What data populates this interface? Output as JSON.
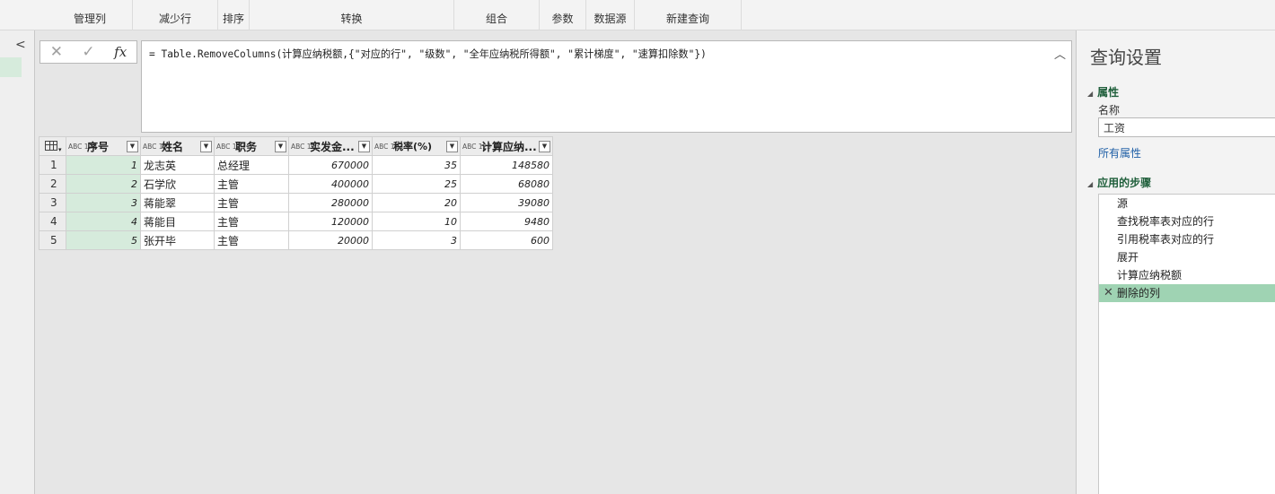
{
  "ribbon": {
    "groups": [
      "管理列",
      "减少行",
      "排序",
      "转换",
      "组合",
      "参数",
      "数据源",
      "新建查询"
    ]
  },
  "queries_pane": {
    "collapse_icon": "chevron-left-icon"
  },
  "formula_bar": {
    "cancel_icon": "✕",
    "commit_icon": "✓",
    "fx_label": "fx",
    "expression": "= Table.RemoveColumns(计算应纳税额,{\"对应的行\", \"级数\", \"全年应纳税所得额\", \"累计梯度\", \"速算扣除数\"})",
    "expand_icon": "chevron-up-icon"
  },
  "table": {
    "type_label": "ABC 123",
    "columns": [
      "序号",
      "姓名",
      "职务",
      "实发金...",
      "税率(%)",
      "计算应纳..."
    ],
    "rows": [
      {
        "n": "1",
        "cells": [
          "1",
          "龙志英",
          "总经理",
          "670000",
          "35",
          "148580"
        ]
      },
      {
        "n": "2",
        "cells": [
          "2",
          "石学欣",
          "主管",
          "400000",
          "25",
          "68080"
        ]
      },
      {
        "n": "3",
        "cells": [
          "3",
          "蒋能翠",
          "主管",
          "280000",
          "20",
          "39080"
        ]
      },
      {
        "n": "4",
        "cells": [
          "4",
          "蒋能目",
          "主管",
          "120000",
          "10",
          "9480"
        ]
      },
      {
        "n": "5",
        "cells": [
          "5",
          "张开毕",
          "主管",
          "20000",
          "3",
          "600"
        ]
      }
    ]
  },
  "settings": {
    "title": "查询设置",
    "properties_header": "属性",
    "name_label": "名称",
    "name_value": "工资",
    "all_properties_link": "所有属性",
    "steps_header": "应用的步骤",
    "steps": [
      "源",
      "查找税率表对应的行",
      "引用税率表对应的行",
      "展开",
      "计算应纳税额",
      "删除的列"
    ],
    "active_step_index": 5
  },
  "colors": {
    "accent_green": "#1e5e3a",
    "selected_step": "#9fd3b3",
    "index_column": "#d6ebdc",
    "link_blue": "#1f5fa6"
  }
}
